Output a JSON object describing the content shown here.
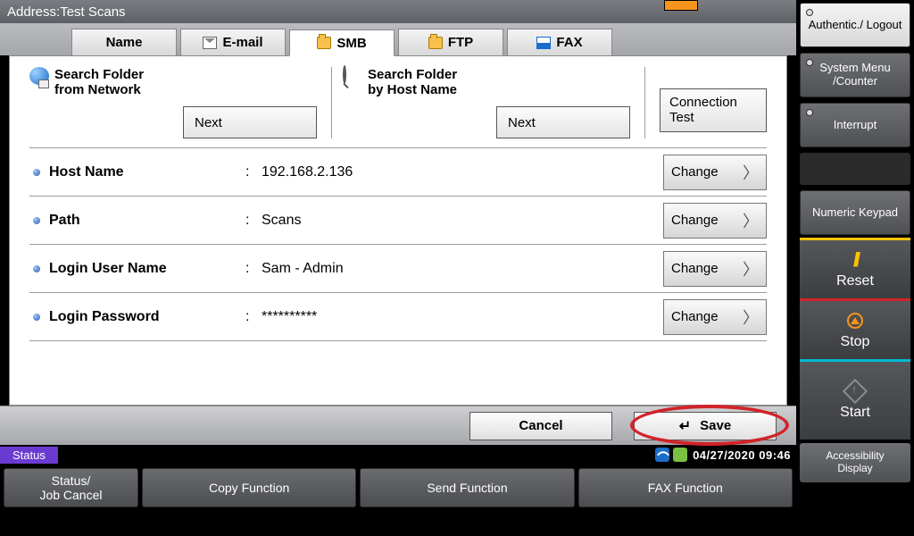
{
  "title": "Address:Test Scans",
  "tabs": [
    {
      "label": "Name"
    },
    {
      "label": "E-mail"
    },
    {
      "label": "SMB"
    },
    {
      "label": "FTP"
    },
    {
      "label": "FAX"
    }
  ],
  "search": {
    "network_line1": "Search Folder",
    "network_line2": "from Network",
    "host_line1": "Search Folder",
    "host_line2": "by Host Name",
    "next": "Next",
    "conn_line1": "Connection",
    "conn_line2": "Test"
  },
  "fields": [
    {
      "label": "Host Name",
      "value": "192.168.2.136"
    },
    {
      "label": "Path",
      "value": "Scans"
    },
    {
      "label": "Login User Name",
      "value": "Sam - Admin"
    },
    {
      "label": "Login Password",
      "value": "**********"
    }
  ],
  "change": "Change",
  "actions": {
    "cancel": "Cancel",
    "save": "Save"
  },
  "status": {
    "label": "Status",
    "datetime": "04/27/2020  09:46"
  },
  "func": {
    "status_job": "Status/\nJob Cancel",
    "copy": "Copy Function",
    "send": "Send Function",
    "fax": "FAX Function",
    "access": "Accessibility\nDisplay"
  },
  "side": {
    "auth": "Authentic./\nLogout",
    "sysmenu": "System Menu\n/Counter",
    "interrupt": "Interrupt",
    "keypad": "Numeric\nKeypad",
    "reset": "Reset",
    "stop": "Stop",
    "start": "Start"
  }
}
